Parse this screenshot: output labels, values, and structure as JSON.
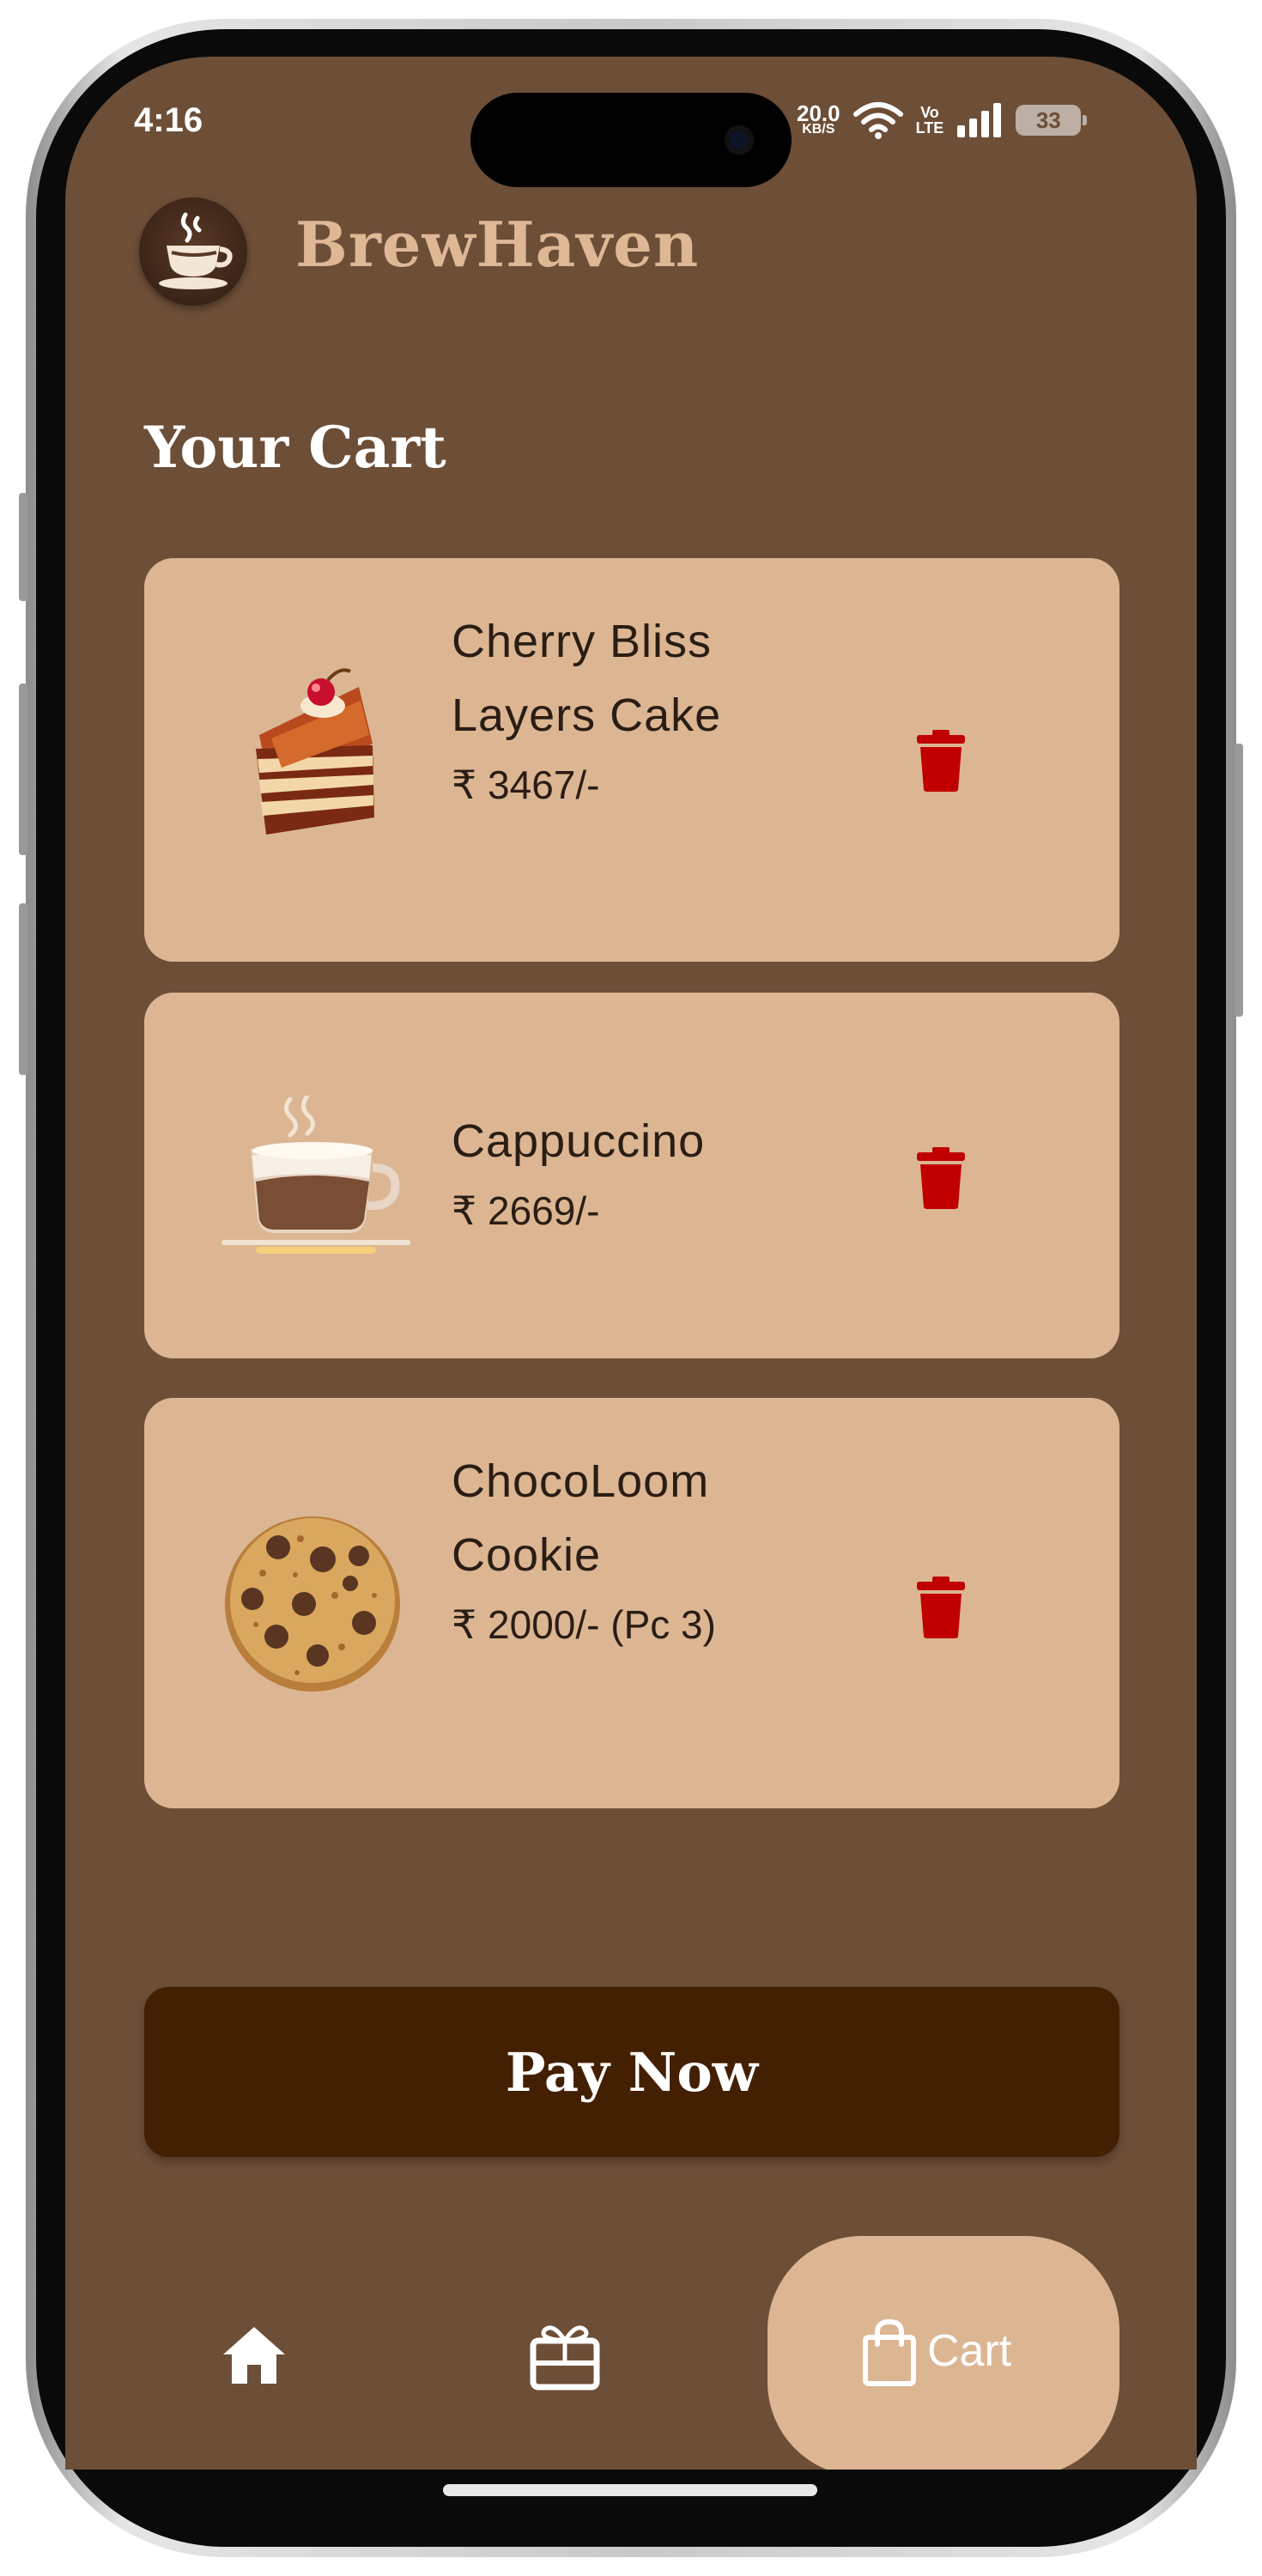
{
  "status_bar": {
    "time": "4:16",
    "speed_value": "20.0",
    "speed_unit": "KB/S",
    "network_label_top": "Vo",
    "network_label_bottom": "LTE",
    "battery": "33"
  },
  "header": {
    "app_name": "BrewHaven",
    "logo_icon": "coffee-cup-logo-icon"
  },
  "page": {
    "title": "Your Cart"
  },
  "cart": {
    "items": [
      {
        "name_line1": "Cherry Bliss",
        "name_line2": "Layers Cake",
        "price": "₹ 3467/-",
        "image": "cake-slice-image"
      },
      {
        "name_line1": "Cappuccino",
        "name_line2": "",
        "price": "₹ 2669/-",
        "image": "cappuccino-cup-image"
      },
      {
        "name_line1": "ChocoLoom",
        "name_line2": "Cookie",
        "price": "₹ 2000/- (Pc 3)",
        "image": "chocolate-chip-cookie-image"
      }
    ],
    "delete_icon": "trash-icon",
    "delete_color": "#c00000"
  },
  "actions": {
    "pay_label": "Pay Now"
  },
  "bottom_nav": {
    "items": [
      {
        "icon": "home-icon",
        "label": ""
      },
      {
        "icon": "gift-card-icon",
        "label": ""
      },
      {
        "icon": "shopping-bag-icon",
        "label": "Cart",
        "active": true
      }
    ]
  },
  "colors": {
    "background": "#6d4e37",
    "card": "#dcb693",
    "title_accent": "#deb795",
    "pay_button": "#442003",
    "delete": "#c00000"
  }
}
